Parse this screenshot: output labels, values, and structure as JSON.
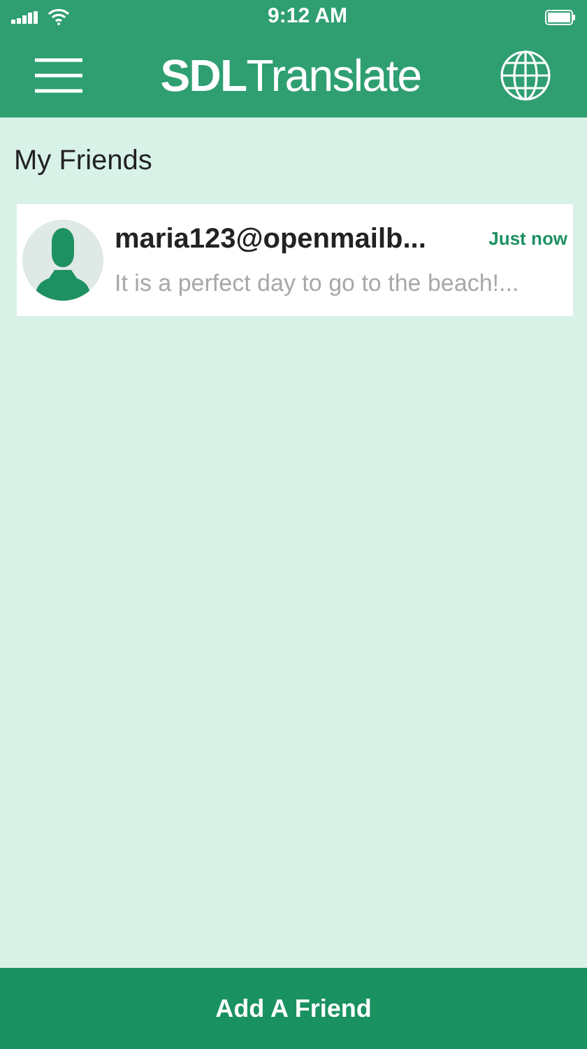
{
  "status_bar": {
    "time": "9:12 AM"
  },
  "header": {
    "logo": "**SDL**Translate"
  },
  "section_title": "My Friends",
  "friends": [
    {
      "name": "maria123@openmailb...",
      "time": "Just now",
      "message": "It is a perfect day to go to the beach!..."
    }
  ],
  "footer_button": "Add A Friend"
}
